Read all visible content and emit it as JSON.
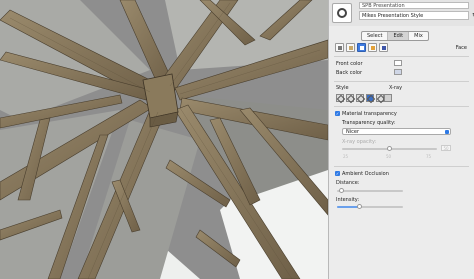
{
  "panel": {
    "style_name": "SPB Presentation",
    "style_desc": "Mikes Presentation Style",
    "tabs": [
      {
        "label": "Select",
        "active": false
      },
      {
        "label": "Edit",
        "active": true
      },
      {
        "label": "Mix",
        "active": false
      }
    ],
    "section": "Face",
    "front_color_label": "Front color",
    "back_color_label": "Back color",
    "front_color": "#ffffff",
    "back_color": "#cfd6e6",
    "style_label": "Style",
    "xray_label": "X-ray",
    "material_transparency_label": "Material transparency",
    "material_transparency_checked": true,
    "transparency_quality_label": "Transparency quality:",
    "transparency_quality_value": "Nicer",
    "xray_opacity_label": "X-ray opacity:",
    "xray_opacity_value": "50",
    "xray_ticks": [
      "25",
      "50",
      "75"
    ],
    "ambient_occlusion_label": "Ambient Occlusion",
    "ambient_occlusion_checked": true,
    "distance_label": "Distance:",
    "intensity_label": "Intensity:",
    "accent_color": "#2f7ae5"
  }
}
